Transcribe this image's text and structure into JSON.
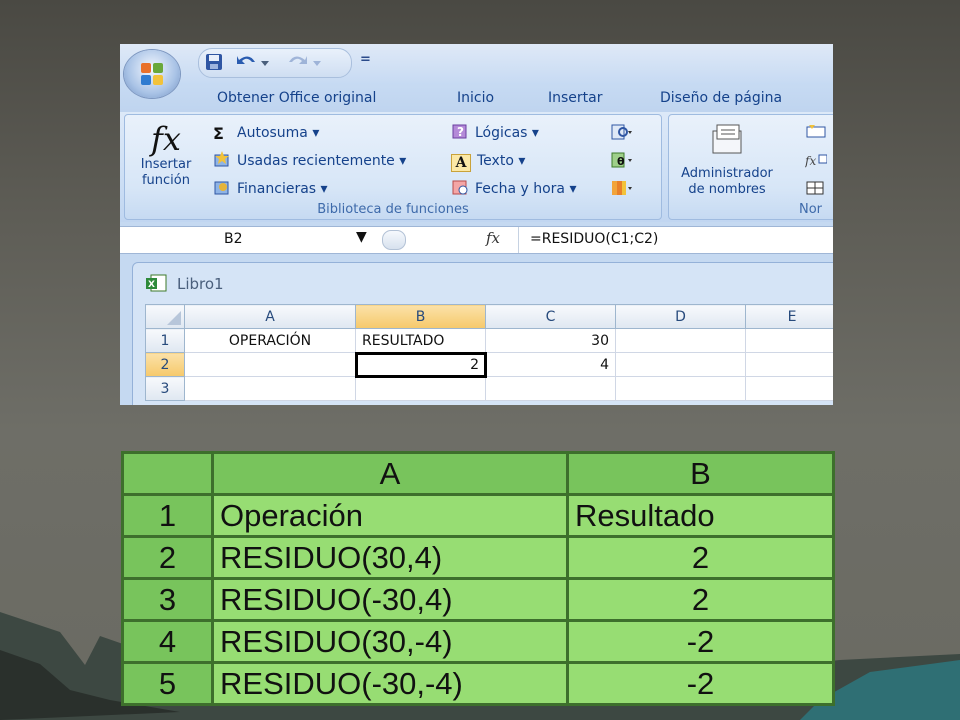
{
  "excel": {
    "quick_access": {
      "save_icon": "save-icon",
      "undo_icon": "undo-icon",
      "redo_icon": "redo-icon",
      "customize_symbol": "="
    },
    "tabs": [
      "Obtener Office original",
      "Inicio",
      "Insertar",
      "Diseño de página"
    ],
    "ribbon": {
      "biblioteca": {
        "group_label": "Biblioteca de funciones",
        "insertar_funcion": {
          "icon_text": "fx",
          "label_line1": "Insertar",
          "label_line2": "función"
        },
        "col1": [
          "Autosuma",
          "Usadas recientemente",
          "Financieras"
        ],
        "col1_symbol": "Σ",
        "col2": [
          "Lógicas",
          "Texto",
          "Fecha y hora"
        ],
        "col2_text_symbol": "A"
      },
      "nombres": {
        "group_label_partial": "Nor",
        "administrador_line1": "Administrador",
        "administrador_line2": "de nombres"
      }
    },
    "formula_bar": {
      "name_box": "B2",
      "dropdown_symbol": "▼",
      "fx_symbol": "fx",
      "formula": "=RESIDUO(C1;C2)"
    },
    "workbook": {
      "title": "Libro1",
      "columns": [
        "A",
        "B",
        "C",
        "D",
        "E"
      ],
      "selected_column": "B",
      "selected_row": "2",
      "rows": [
        {
          "num": "1",
          "cells": [
            "OPERACIÓN",
            "RESULTADO",
            "30",
            "",
            ""
          ]
        },
        {
          "num": "2",
          "cells": [
            "",
            "2",
            "4",
            "",
            ""
          ]
        },
        {
          "num": "3",
          "cells": [
            "",
            "",
            "",
            "",
            ""
          ]
        }
      ]
    },
    "colors": {
      "ribbon_blue": "#c5d9f1",
      "tab_text": "#15428b",
      "selected_header": "#f6c96b"
    }
  },
  "residuo_table": {
    "col_headers": [
      "A",
      "B"
    ],
    "rows": [
      {
        "num": "1",
        "operacion": "Operación",
        "resultado": "Resultado"
      },
      {
        "num": "2",
        "operacion": "RESIDUO(30,4)",
        "resultado": "2"
      },
      {
        "num": "3",
        "operacion": "RESIDUO(-30,4)",
        "resultado": "2"
      },
      {
        "num": "4",
        "operacion": "RESIDUO(30,-4)",
        "resultado": "-2"
      },
      {
        "num": "5",
        "operacion": "RESIDUO(-30,-4)",
        "resultado": "-2"
      }
    ],
    "colors": {
      "cell_green": "#97dd73",
      "border_green": "#3d6f2c"
    }
  }
}
